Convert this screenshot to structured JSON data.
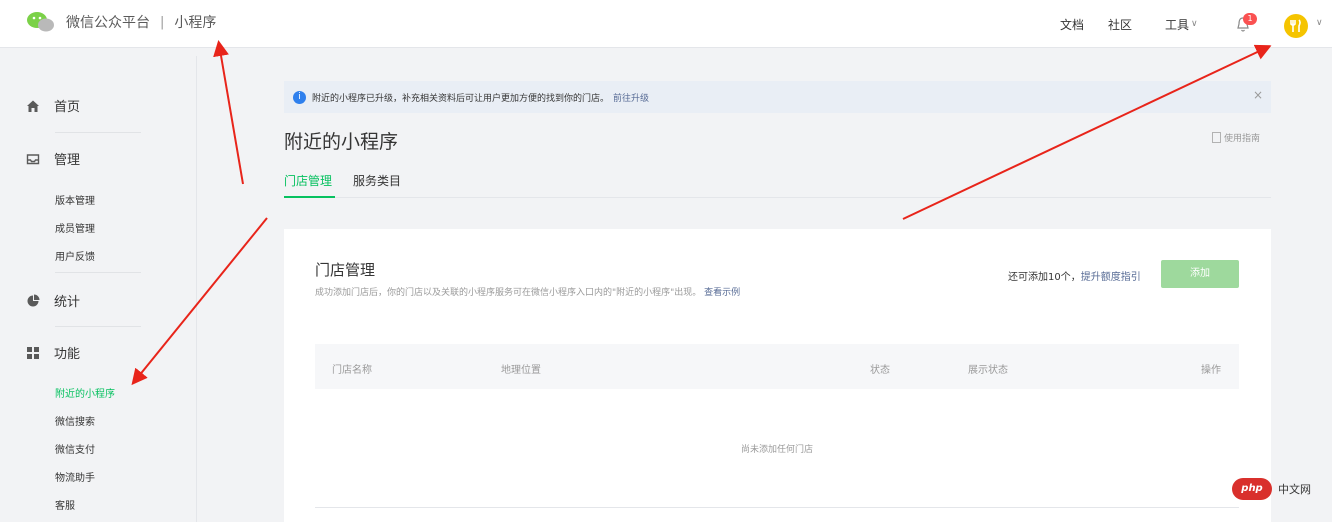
{
  "header": {
    "brand_name": "微信公众平台",
    "brand_sep": "|",
    "brand_sub": "小程序",
    "nav": {
      "docs": "文档",
      "community": "社区",
      "tools": "工具"
    },
    "notification_count": "1",
    "avatar_color": "#f5c400"
  },
  "sidebar": {
    "groups": [
      {
        "label": "首页",
        "icon": "home-icon"
      },
      {
        "label": "管理",
        "icon": "inbox-icon"
      },
      {
        "label": "统计",
        "icon": "pie-chart-icon"
      },
      {
        "label": "功能",
        "icon": "grid-icon"
      }
    ],
    "manage_items": [
      "版本管理",
      "成员管理",
      "用户反馈"
    ],
    "feature_items": [
      "附近的小程序",
      "微信搜索",
      "微信支付",
      "物流助手",
      "客服"
    ],
    "active_item": "附近的小程序",
    "accent_color": "#07c160"
  },
  "notice": {
    "text": "附近的小程序已升级，补充相关资料后可让用户更加方便的找到你的门店。",
    "link": "前往升级",
    "close": "×"
  },
  "page": {
    "title": "附近的小程序",
    "guide": "使用指南",
    "tabs": [
      "门店管理",
      "服务类目"
    ]
  },
  "card": {
    "title": "门店管理",
    "desc": "成功添加门店后，你的门店以及关联的小程序服务可在微信小程序入口内的\"附近的小程序\"出现。",
    "desc_link": "查看示例",
    "quota_text": "还可添加10个，",
    "quota_link": "提升额度指引",
    "add_button": "添加",
    "table_headers": [
      "门店名称",
      "地理位置",
      "状态",
      "展示状态",
      "操作"
    ],
    "empty_text": "尚未添加任何门店"
  },
  "watermark": {
    "logo": "php",
    "text": "中文网"
  }
}
